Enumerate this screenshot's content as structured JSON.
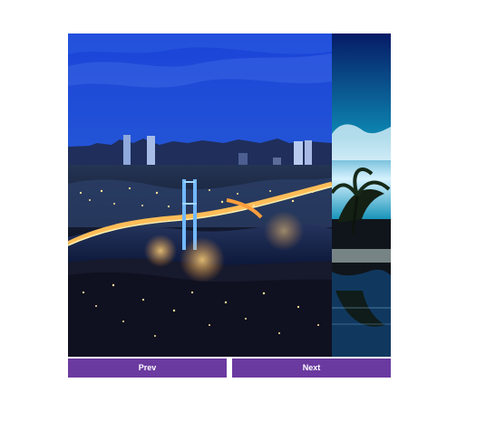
{
  "carousel": {
    "slides": [
      {
        "scene": "istanbul-night-bridge",
        "accent": "#1d44d6"
      },
      {
        "scene": "palm-trees-water-reflection",
        "accent": "#0f88b4"
      }
    ],
    "buttons": {
      "prev_label": "Prev",
      "next_label": "Next",
      "color": "#6b3aa0"
    }
  }
}
